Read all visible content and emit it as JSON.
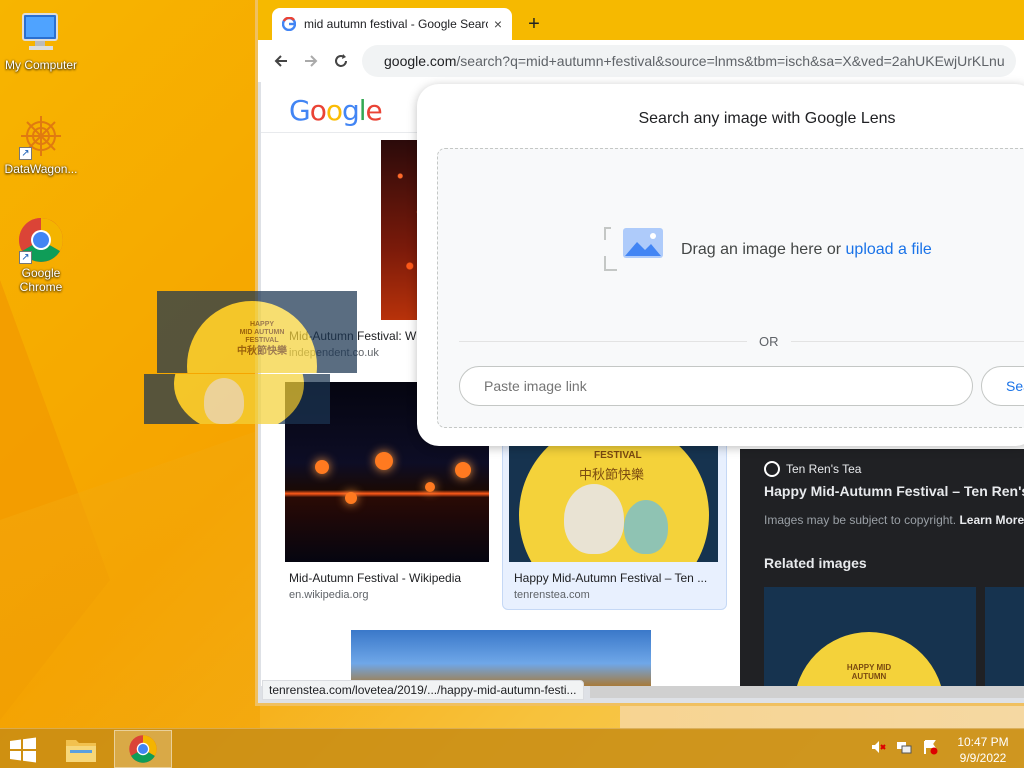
{
  "desktop": {
    "icons": [
      {
        "label": "My Computer",
        "icon": "computer-icon"
      },
      {
        "label": "DataWagon...",
        "icon": "datawagon-icon"
      },
      {
        "label": "Google Chrome",
        "icon": "chrome-icon"
      }
    ]
  },
  "browser": {
    "tab": {
      "title": "mid autumn festival - Google Search",
      "close": "×"
    },
    "new_tab": "+",
    "address": {
      "host": "google.com",
      "path": "/search?q=mid+autumn+festival&source=lnms&tbm=isch&sa=X&ved=2ahUKEwjUrKLnu"
    },
    "logo": "Google"
  },
  "results": [
    {
      "caption": "Mid-Autumn Festival: Wh",
      "source": "independent.co.uk"
    },
    {
      "caption": "Mid-Autumn Festival - Wikipedia",
      "source": "en.wikipedia.org"
    },
    {
      "caption": "Happy Mid-Autumn Festival – Ten ...",
      "source": "tenrenstea.com"
    }
  ],
  "result_image_text": {
    "festival": "FESTIVAL",
    "chinese": "中秋節快樂"
  },
  "preview": {
    "source_name": "Ten Ren's Tea",
    "title": "Happy Mid-Autumn Festival – Ten Ren's",
    "copyright": "Images may be subject to copyright.",
    "learn_more": "Learn More",
    "related": "Related images",
    "related_text": "HAPPY MID AUTUMN"
  },
  "lens": {
    "heading": "Search any image with Google Lens",
    "drag_text": "Drag an image here or ",
    "upload_link": "upload a file",
    "or": "OR",
    "paste_placeholder": "Paste image link",
    "search_button": "Search"
  },
  "drag_ghost": {
    "line1": "HAPPY",
    "line2": "MID AUTUMN",
    "line3": "FESTIVAL",
    "line4": "中秋節快樂"
  },
  "status_url": "tenrenstea.com/lovetea/2019/.../happy-mid-autumn-festi...",
  "taskbar": {
    "time": "10:47 PM",
    "date": "9/9/2022"
  },
  "colors": {
    "google_blue": "#4285f4",
    "google_red": "#ea4335",
    "google_yellow": "#fbbc05",
    "google_green": "#34a853",
    "link": "#1a73e8"
  }
}
